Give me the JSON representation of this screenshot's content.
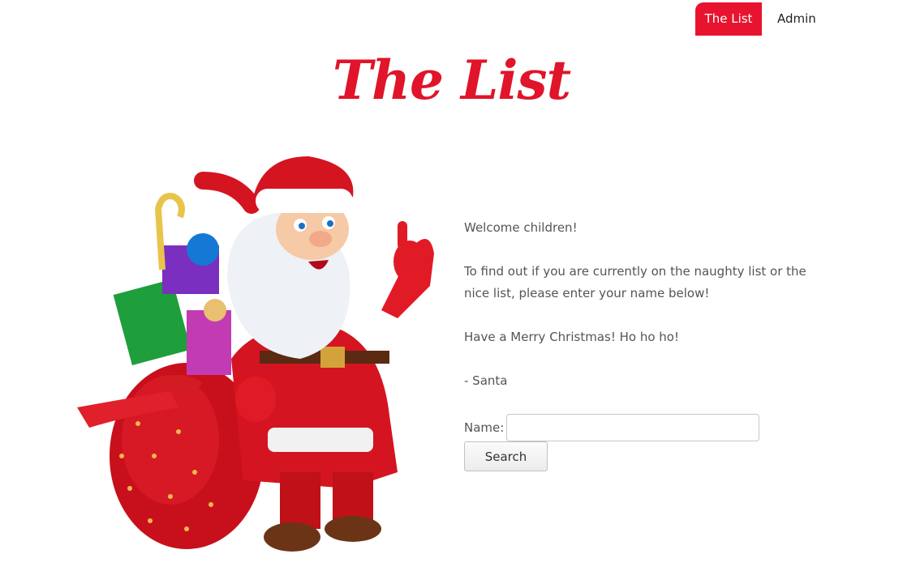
{
  "nav": {
    "items": [
      {
        "label": "The List",
        "active": true
      },
      {
        "label": "Admin",
        "active": false
      }
    ]
  },
  "page": {
    "title": "The List"
  },
  "intro": {
    "greeting": "Welcome children!",
    "instructions": "To find out if you are currently on the naughty list or the nice list, please enter your name below!",
    "wishes": "Have a Merry Christmas! Ho ho ho!",
    "signature": "- Santa"
  },
  "form": {
    "name_label": "Name:",
    "name_value": "",
    "search_label": "Search"
  },
  "colors": {
    "accent": "#e8142f",
    "title": "#e0142a",
    "text": "#555555"
  },
  "illustration": {
    "icon": "santa-illustration"
  }
}
